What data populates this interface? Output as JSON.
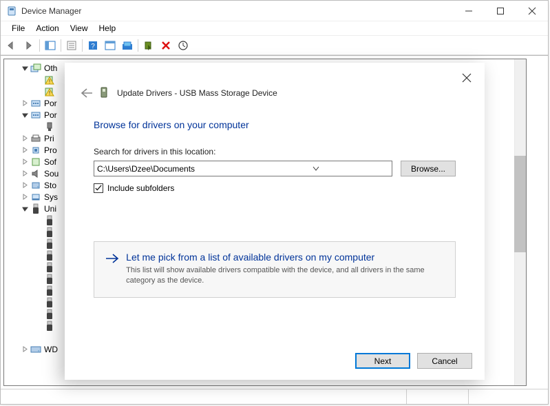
{
  "window": {
    "title": "Device Manager"
  },
  "menubar": {
    "items": [
      "File",
      "Action",
      "View",
      "Help"
    ]
  },
  "tree": {
    "root_label": "Oth",
    "items": [
      {
        "expander": "open",
        "indent": 24,
        "icon": "devices",
        "label": "Oth"
      },
      {
        "expander": "none",
        "indent": 44,
        "icon": "warn",
        "label": ""
      },
      {
        "expander": "none",
        "indent": 44,
        "icon": "warn",
        "label": ""
      },
      {
        "expander": "closed",
        "indent": 24,
        "icon": "port",
        "label": "Por"
      },
      {
        "expander": "open",
        "indent": 24,
        "icon": "port",
        "label": "Por"
      },
      {
        "expander": "none",
        "indent": 44,
        "icon": "plug",
        "label": ""
      },
      {
        "expander": "closed",
        "indent": 24,
        "icon": "printer",
        "label": "Pri"
      },
      {
        "expander": "closed",
        "indent": 24,
        "icon": "cpu",
        "label": "Pro"
      },
      {
        "expander": "closed",
        "indent": 24,
        "icon": "soft",
        "label": "Sof"
      },
      {
        "expander": "closed",
        "indent": 24,
        "icon": "sound",
        "label": "Sou"
      },
      {
        "expander": "closed",
        "indent": 24,
        "icon": "disk",
        "label": "Sto"
      },
      {
        "expander": "closed",
        "indent": 24,
        "icon": "sys",
        "label": "Sys"
      },
      {
        "expander": "open",
        "indent": 24,
        "icon": "usb",
        "label": "Uni"
      },
      {
        "expander": "none",
        "indent": 44,
        "icon": "usb",
        "label": ""
      },
      {
        "expander": "none",
        "indent": 44,
        "icon": "usb",
        "label": ""
      },
      {
        "expander": "none",
        "indent": 44,
        "icon": "usb",
        "label": ""
      },
      {
        "expander": "none",
        "indent": 44,
        "icon": "usb",
        "label": ""
      },
      {
        "expander": "none",
        "indent": 44,
        "icon": "usb",
        "label": ""
      },
      {
        "expander": "none",
        "indent": 44,
        "icon": "usb",
        "label": ""
      },
      {
        "expander": "none",
        "indent": 44,
        "icon": "usb",
        "label": ""
      },
      {
        "expander": "none",
        "indent": 44,
        "icon": "usb",
        "label": ""
      },
      {
        "expander": "none",
        "indent": 44,
        "icon": "usb",
        "label": ""
      },
      {
        "expander": "none",
        "indent": 44,
        "icon": "usb",
        "label": ""
      },
      {
        "expander": "none",
        "indent": 2,
        "icon": "none",
        "label": ""
      },
      {
        "expander": "closed",
        "indent": 24,
        "icon": "wd",
        "label": "WD"
      }
    ]
  },
  "dialog": {
    "title": "Update Drivers - USB Mass Storage Device",
    "heading": "Browse for drivers on your computer",
    "search_label": "Search for drivers in this location:",
    "path_value": "C:\\Users\\Dzee\\Documents",
    "browse_label": "Browse...",
    "include_subfolders": "Include subfolders",
    "option_title": "Let me pick from a list of available drivers on my computer",
    "option_desc": "This list will show available drivers compatible with the device, and all drivers in the same category as the device.",
    "next": "Next",
    "cancel": "Cancel"
  }
}
